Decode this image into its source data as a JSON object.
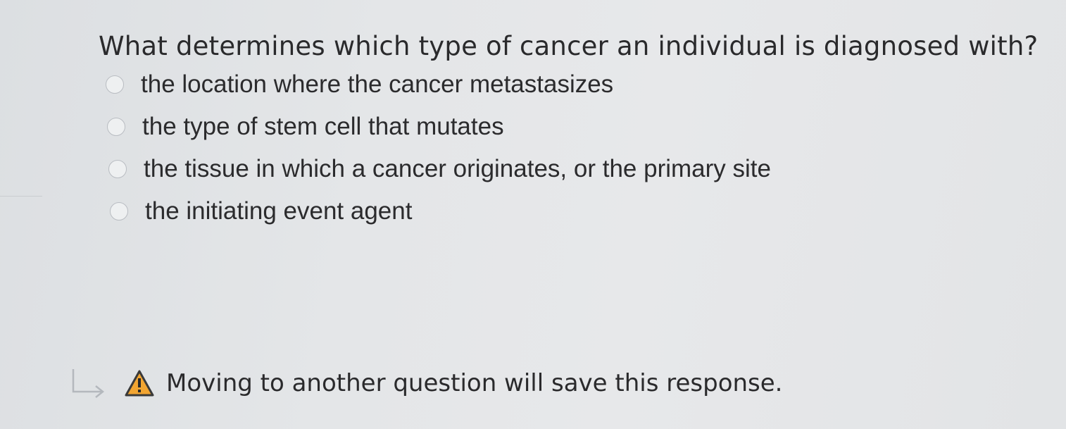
{
  "question": {
    "text": "What determines which type of cancer an individual is diagnosed with?"
  },
  "options": [
    {
      "label": "the location where the cancer metastasizes",
      "selected": false
    },
    {
      "label": "the type of stem cell that mutates",
      "selected": false
    },
    {
      "label": "the tissue in which a cancer originates, or the primary site",
      "selected": false
    },
    {
      "label": "the initiating event agent",
      "selected": false
    }
  ],
  "footer": {
    "arrow_icon": "return-arrow-icon",
    "warning_icon": "warning-icon",
    "warning_color": "#f2a531",
    "text": "Moving to another question will save this response."
  }
}
